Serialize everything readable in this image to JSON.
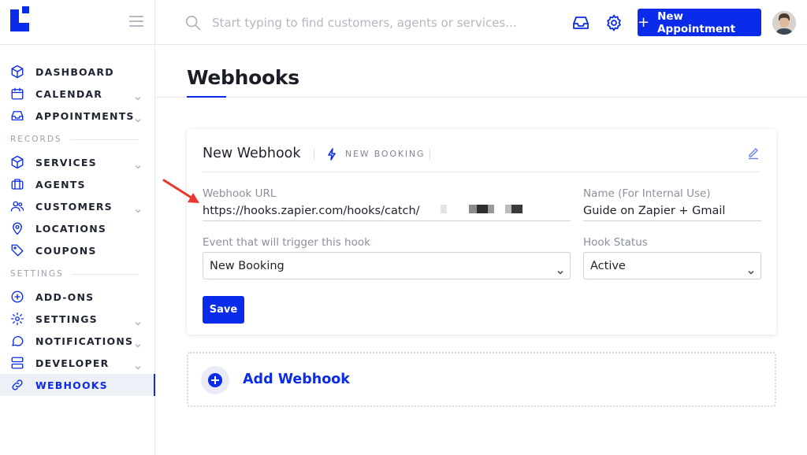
{
  "sidebar": {
    "nav": [
      {
        "label": "DASHBOARD",
        "icon": "cube-icon",
        "chevron": false
      },
      {
        "label": "CALENDAR",
        "icon": "calendar-icon",
        "chevron": true
      },
      {
        "label": "APPOINTMENTS",
        "icon": "inbox-icon",
        "chevron": true
      }
    ],
    "records_heading": "RECORDS",
    "records": [
      {
        "label": "SERVICES",
        "icon": "cube-icon",
        "chevron": true
      },
      {
        "label": "AGENTS",
        "icon": "briefcase-icon",
        "chevron": false
      },
      {
        "label": "CUSTOMERS",
        "icon": "users-icon",
        "chevron": true
      },
      {
        "label": "LOCATIONS",
        "icon": "map-pin-icon",
        "chevron": false
      },
      {
        "label": "COUPONS",
        "icon": "tag-icon",
        "chevron": false
      }
    ],
    "settings_heading": "SETTINGS",
    "settings": [
      {
        "label": "ADD-ONS",
        "icon": "plus-circle-icon",
        "chevron": false
      },
      {
        "label": "SETTINGS",
        "icon": "gear-icon",
        "chevron": true
      },
      {
        "label": "NOTIFICATIONS",
        "icon": "chat-bubble-icon",
        "chevron": true
      },
      {
        "label": "DEVELOPER",
        "icon": "server-icon",
        "chevron": true
      },
      {
        "label": "WEBHOOKS",
        "icon": "link-icon",
        "chevron": false,
        "active": true
      }
    ]
  },
  "topbar": {
    "search_placeholder": "Start typing to find customers, agents or services...",
    "new_appointment_label": "New Appointment"
  },
  "page": {
    "title": "Webhooks"
  },
  "webhook_card": {
    "title": "New Webhook",
    "event_tag": "NEW BOOKING",
    "url_label": "Webhook URL",
    "url_value": "https://hooks.zapier.com/hooks/catch/",
    "name_label": "Name (For Internal Use)",
    "name_value": "Guide on Zapier + Gmail",
    "event_label": "Event that will trigger this hook",
    "event_value": "New Booking",
    "status_label": "Hook Status",
    "status_value": "Active",
    "save_label": "Save"
  },
  "add_webhook": {
    "label": "Add Webhook"
  },
  "colors": {
    "accent": "#0a2bea",
    "arrow": "#e8382f"
  }
}
